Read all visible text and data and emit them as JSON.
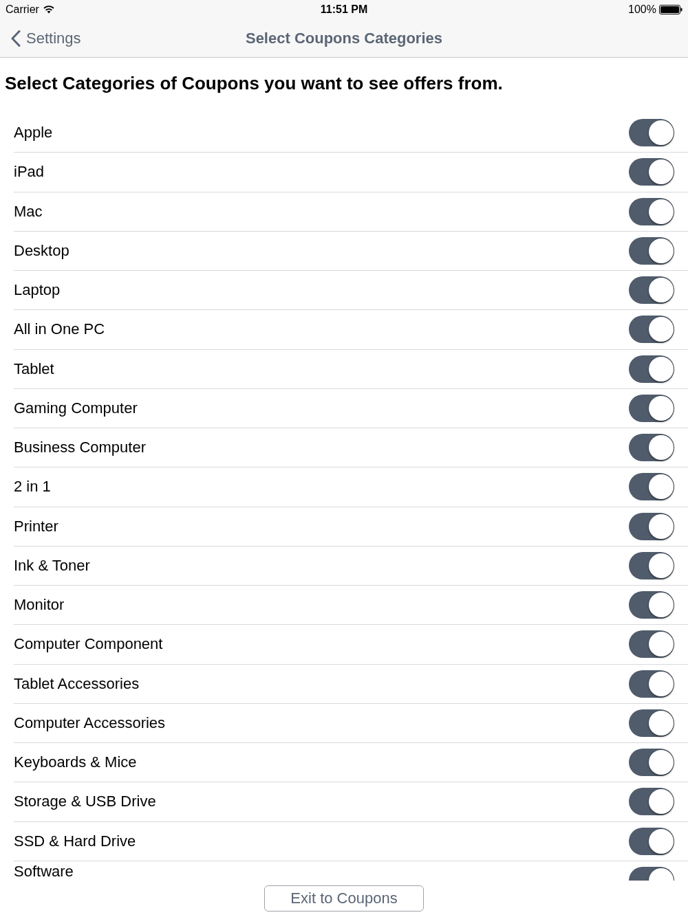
{
  "status_bar": {
    "carrier": "Carrier",
    "time": "11:51 PM",
    "battery": "100%"
  },
  "nav": {
    "back": "Settings",
    "title": "Select Coupons Categories"
  },
  "heading": "Select Categories of Coupons you want to see offers from.",
  "categories": [
    {
      "label": "Apple",
      "on": true
    },
    {
      "label": "iPad",
      "on": true
    },
    {
      "label": "Mac",
      "on": true
    },
    {
      "label": "Desktop",
      "on": true
    },
    {
      "label": "Laptop",
      "on": true
    },
    {
      "label": "All in One PC",
      "on": true
    },
    {
      "label": "Tablet",
      "on": true
    },
    {
      "label": "Gaming Computer",
      "on": true
    },
    {
      "label": "Business Computer",
      "on": true
    },
    {
      "label": "2 in 1",
      "on": true
    },
    {
      "label": "Printer",
      "on": true
    },
    {
      "label": "Ink & Toner",
      "on": true
    },
    {
      "label": "Monitor",
      "on": true
    },
    {
      "label": "Computer Component",
      "on": true
    },
    {
      "label": "Tablet Accessories",
      "on": true
    },
    {
      "label": "Computer Accessories",
      "on": true
    },
    {
      "label": "Keyboards & Mice",
      "on": true
    },
    {
      "label": "Storage & USB Drive",
      "on": true
    },
    {
      "label": "SSD & Hard Drive",
      "on": true
    },
    {
      "label": "Software",
      "on": true
    }
  ],
  "footer": {
    "button": "Exit to Coupons"
  }
}
